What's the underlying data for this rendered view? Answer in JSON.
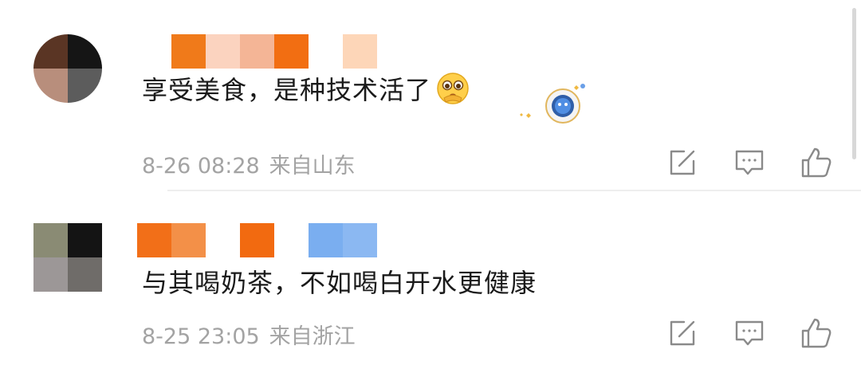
{
  "comments": [
    {
      "text": "享受美食，是种技术活了",
      "emoji_icon": "pleading-face-icon",
      "sticker_icon": "astronaut-badge-icon",
      "time": "8-26 08:28",
      "location": "来自山东",
      "avatar_colors": [
        "#5a3524",
        "#151515",
        "#b88e7c",
        "#5c5c5c"
      ],
      "name_mosaic_colors": [
        "#f07a1a",
        "#fbd3bf",
        "#f4b596",
        "#f26e12",
        "#ffffff",
        "#fdd6b8"
      ]
    },
    {
      "text": "与其喝奶茶，不如喝白开水更健康",
      "time": "8-25 23:05",
      "location": "来自浙江",
      "avatar_colors": [
        "#8a8b74",
        "#141414",
        "#9c9797",
        "#6f6c69"
      ],
      "name_mosaic_colors": [
        "#f26f18",
        "#f39048",
        "#ffffff",
        "#f26a10",
        "#ffffff",
        "#7aaef0",
        "#8bb8f2"
      ]
    }
  ],
  "actions": {
    "repost_icon": "repost-edit-icon",
    "comment_icon": "comment-bubble-icon",
    "like_icon": "thumbs-up-icon"
  },
  "colors": {
    "meta_text": "#a3a3a3",
    "icon_stroke": "#8a8a8a",
    "divider": "#eeeeee"
  }
}
